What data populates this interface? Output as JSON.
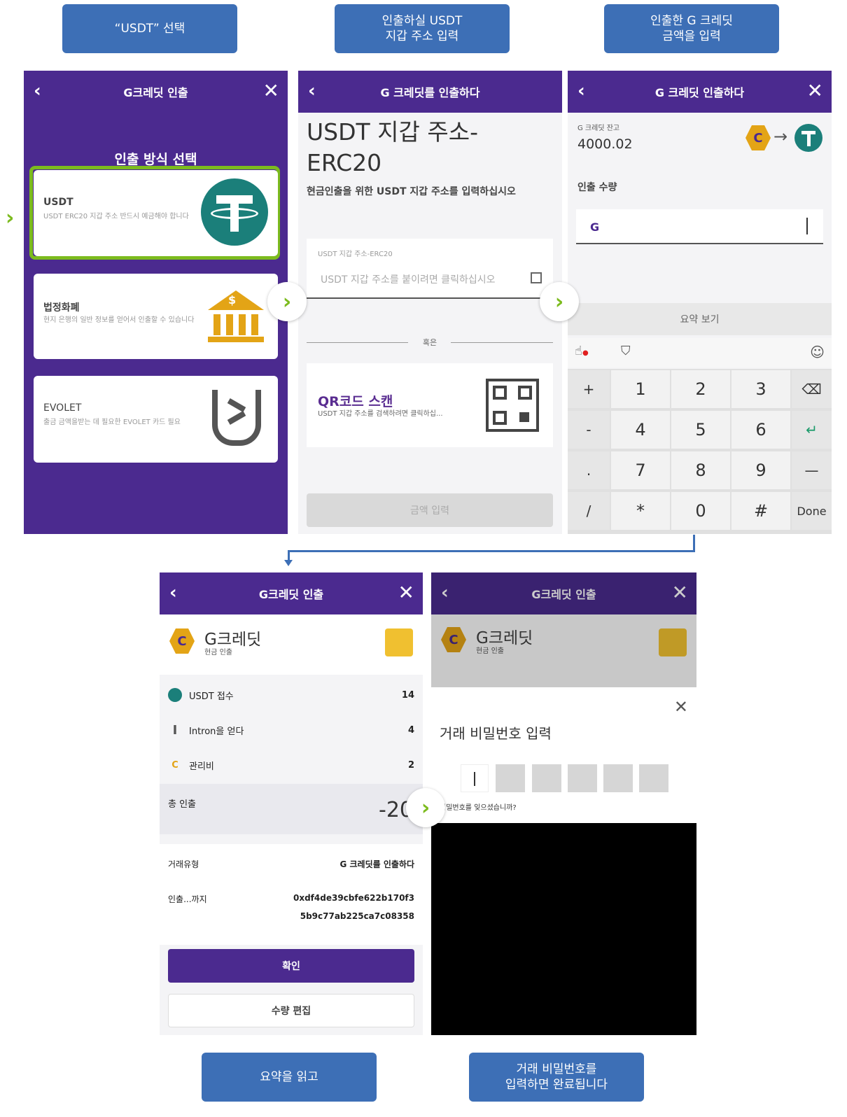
{
  "captions": {
    "step1": "“USDT” 선택",
    "step2": "인출하실 USDT\n지갑 주소 입력",
    "step3": "인출한 G 크레딧\n금액을 입력",
    "step4": "요약을 읽고",
    "step5": "거래 비밀번호를\n입력하면 완료됩니다"
  },
  "screen1": {
    "title": "G크레딧 인출",
    "heading": "인출 방식 선택",
    "options": [
      {
        "name": "USDT",
        "desc": "USDT ERC20 지갑 주소 반드시 예금해야 합니다",
        "icon": "tether-icon"
      },
      {
        "name": "법정화폐",
        "desc": "현지 은행의 일반 정보를 얻어서 인출할 수 있습니다",
        "icon": "bank-icon"
      },
      {
        "name": "EVOLET",
        "desc": "출금 금액을받는 데 필요한 EVOLET 카드 필요",
        "icon": "evolet-icon"
      }
    ]
  },
  "screen2": {
    "title": "G 크레딧를 인출하다",
    "heading": "USDT 지갑 주소-\nERC20",
    "subheading": "현금인출을 위한 USDT 지갑 주소를 입력하십시오",
    "field_label": "USDT 지갑 주소-ERC20",
    "field_placeholder": "USDT 지갑 주소를 붙이려면 클릭하십시오",
    "divider": "혹은",
    "qr_title": "QR코드 스캔",
    "qr_desc": "USDT 지갑 주소를 검색하려면 클릭하십...",
    "submit": "금액 입력"
  },
  "screen3": {
    "title": "G 크레딧 인출하다",
    "balance_label": "G 크레딧 잔고",
    "balance": "4000.02",
    "amount_label": "인출 수량",
    "amount_value": "",
    "summary_button": "요약 보기",
    "keys": [
      [
        "+",
        "1",
        "2",
        "3",
        "⌫"
      ],
      [
        "-",
        "4",
        "5",
        "6",
        "↵"
      ],
      [
        ".",
        "7",
        "8",
        "9",
        "—"
      ],
      [
        "/",
        "*",
        "0",
        "#",
        "Done"
      ]
    ]
  },
  "screen4": {
    "title": "G크레딧 인출",
    "brand": "G크레딧",
    "brand_sub": "현금 인출",
    "rows": [
      {
        "label": "USDT 접수",
        "value": "14"
      },
      {
        "label": "Intron을 얻다",
        "value": "4"
      },
      {
        "label": "관리비",
        "value": "2"
      }
    ],
    "total_label": "총 인출",
    "total_value": "-20",
    "type_label": "거래유형",
    "type_value": "G 크레딧를 인출하다",
    "to_label": "인출...까지",
    "to_value_1": "0xdf4de39cbfe622b170f3",
    "to_value_2": "5b9c77ab225ca7c08358",
    "confirm": "확인",
    "edit": "수량 편집"
  },
  "screen5": {
    "title": "G크레딧 인출",
    "brand": "G크레딧",
    "brand_sub": "현금 인출",
    "dialog_title": "거래 비밀번호 입력",
    "forgot": "비밀번호를 잊으셨습니까?"
  },
  "colors": {
    "purple": "#4b2a8f",
    "caption": "#3d6fb6",
    "green": "#7cbb1e",
    "teal": "#1b7f7a",
    "gold": "#e3a416"
  }
}
